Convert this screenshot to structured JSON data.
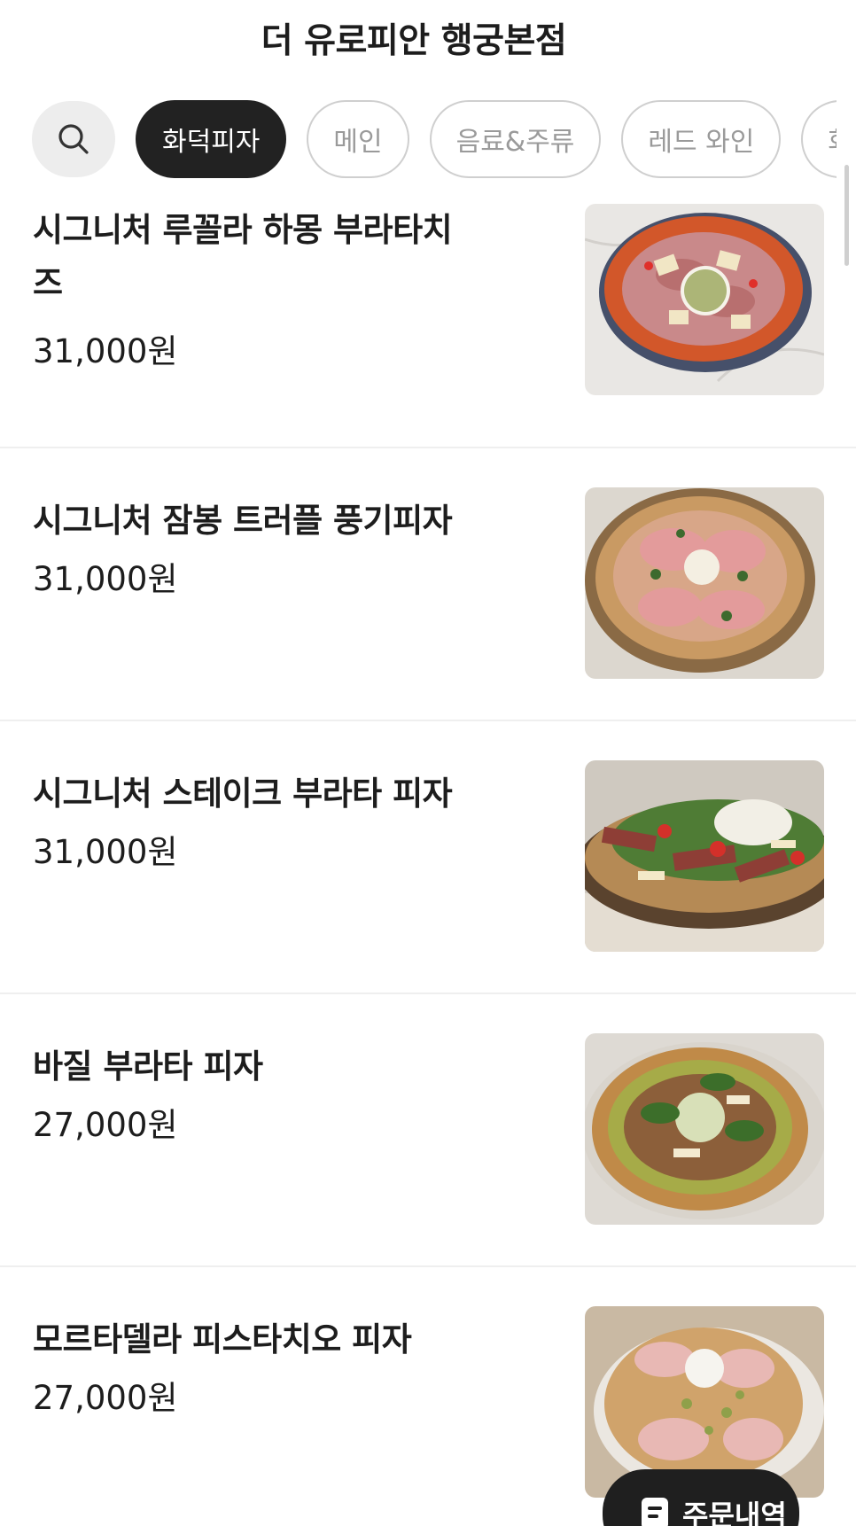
{
  "header": {
    "title": "더 유로피안 행궁본점"
  },
  "tabs": {
    "search_icon": "search-icon",
    "items": [
      {
        "label": "화덕피자",
        "active": true
      },
      {
        "label": "메인",
        "active": false
      },
      {
        "label": "음료&주류",
        "active": false
      },
      {
        "label": "레드 와인",
        "active": false
      },
      {
        "label": "화이",
        "active": false
      }
    ]
  },
  "menu": {
    "items": [
      {
        "name": "시그니처 루꼴라 하몽 부라타치즈",
        "price": "31,000원"
      },
      {
        "name": "시그니처 잠봉 트러플 풍기피자",
        "price": "31,000원"
      },
      {
        "name": "시그니처 스테이크 부라타 피자",
        "price": "31,000원"
      },
      {
        "name": "바질 부라타 피자",
        "price": "27,000원"
      },
      {
        "name": "모르타델라 피스타치오 피자",
        "price": "27,000원"
      }
    ]
  },
  "fab": {
    "label": "주문내역",
    "icon": "receipt-icon"
  }
}
